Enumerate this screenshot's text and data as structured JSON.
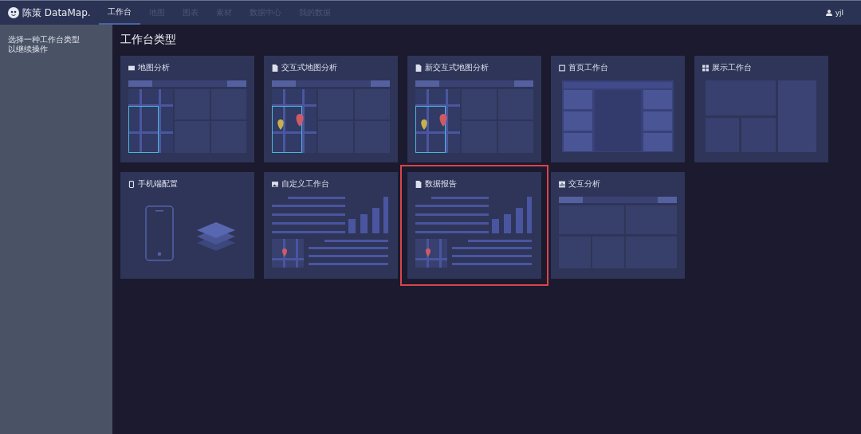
{
  "header": {
    "logo": "陈策 DataMap.",
    "nav": [
      {
        "label": "工作台",
        "selected": true
      },
      {
        "label": "地图",
        "selected": false
      },
      {
        "label": "图表",
        "selected": false
      },
      {
        "label": "素材",
        "selected": false
      },
      {
        "label": "数据中心",
        "selected": false
      },
      {
        "label": "我的数据",
        "selected": false
      }
    ],
    "user": "yjl"
  },
  "sidebar": {
    "hint": [
      "选择一种工作台类型",
      "以继续操作"
    ]
  },
  "main": {
    "title": "工作台类型",
    "cards": [
      {
        "title": "地图分析",
        "kind": "map",
        "selected": false
      },
      {
        "title": "交互式地图分析",
        "kind": "map-pins",
        "selected": false
      },
      {
        "title": "新交互式地图分析",
        "kind": "map-pins",
        "selected": false
      },
      {
        "title": "首页工作台",
        "kind": "home",
        "selected": false
      },
      {
        "title": "展示工作台",
        "kind": "display",
        "selected": false
      },
      {
        "title": "手机端配置",
        "kind": "mobile",
        "selected": false
      },
      {
        "title": "自定义工作台",
        "kind": "report",
        "selected": false
      },
      {
        "title": "数据报告",
        "kind": "report",
        "selected": true
      },
      {
        "title": "交互分析",
        "kind": "analysis",
        "selected": false
      }
    ]
  }
}
